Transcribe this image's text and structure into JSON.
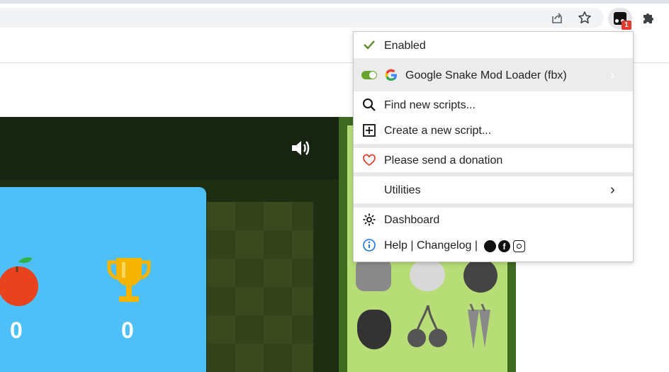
{
  "browser": {
    "extension_badge": "1",
    "icons": [
      "share-icon",
      "star-icon",
      "tampermonkey-icon",
      "puzzle-icon"
    ]
  },
  "game": {
    "apple_score": "0",
    "trophy_score": "0",
    "colors": {
      "score_panel": "#4ec0f7",
      "right_panel": "#b7dd77"
    }
  },
  "menu": {
    "enabled_label": "Enabled",
    "script_name": "Google Snake Mod Loader (fbx)",
    "find_label": "Find new scripts...",
    "create_label": "Create a new script...",
    "donation_label": "Please send a donation",
    "utilities_label": "Utilities",
    "dashboard_label": "Dashboard",
    "help_label": "Help",
    "changelog_label": "Changelog",
    "divider": "|",
    "colors": {
      "check": "#5b8c2a",
      "toggle": "#67a32d",
      "heart": "#e0402d",
      "info": "#1a73e8"
    }
  }
}
